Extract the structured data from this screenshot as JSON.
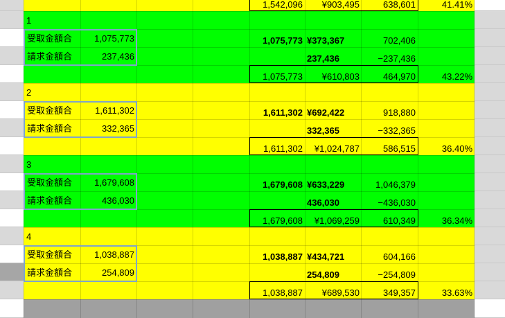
{
  "top_row": {
    "c5": "1,542,096",
    "c6": "¥903,495",
    "c7": "638,601",
    "c8": "41.41%"
  },
  "groups": [
    {
      "id": "1",
      "label_recv": "受取金額合",
      "recv_value": "1,075,773",
      "label_bill": "請求金額合",
      "bill_value": "237,436",
      "r1_c5": "1,075,773",
      "r1_c6": "¥373,367",
      "r1_c7": "702,406",
      "r2_c6": "237,436",
      "r2_c7": "−237,436",
      "t_c5": "1,075,773",
      "t_c6": "¥610,803",
      "t_c7": "464,970",
      "t_pct": "43.22%"
    },
    {
      "id": "2",
      "label_recv": "受取金額合",
      "recv_value": "1,611,302",
      "label_bill": "請求金額合",
      "bill_value": "332,365",
      "r1_c5": "1,611,302",
      "r1_c6": "¥692,422",
      "r1_c7": "918,880",
      "r2_c6": "332,365",
      "r2_c7": "−332,365",
      "t_c5": "1,611,302",
      "t_c6": "¥1,024,787",
      "t_c7": "586,515",
      "t_pct": "36.40%"
    },
    {
      "id": "3",
      "label_recv": "受取金額合",
      "recv_value": "1,679,608",
      "label_bill": "請求金額合",
      "bill_value": "436,030",
      "r1_c5": "1,679,608",
      "r1_c6": "¥633,229",
      "r1_c7": "1,046,379",
      "r2_c6": "436,030",
      "r2_c7": "−436,030",
      "t_c5": "1,679,608",
      "t_c6": "¥1,069,259",
      "t_c7": "610,349",
      "t_pct": "36.34%"
    },
    {
      "id": "4",
      "label_recv": "受取金額合",
      "recv_value": "1,038,887",
      "label_bill": "請求金額合",
      "bill_value": "254,809",
      "r1_c5": "1,038,887",
      "r1_c6": "¥434,721",
      "r1_c7": "604,166",
      "r2_c6": "254,809",
      "r2_c7": "−254,809",
      "t_c5": "1,038,887",
      "t_c6": "¥689,530",
      "t_c7": "349,357",
      "t_pct": "33.63%"
    }
  ],
  "colors": {
    "yellow": "#ffff00",
    "green": "#00ff00",
    "gray": "#a0a0a0",
    "box_border": "#7fa5c9"
  }
}
